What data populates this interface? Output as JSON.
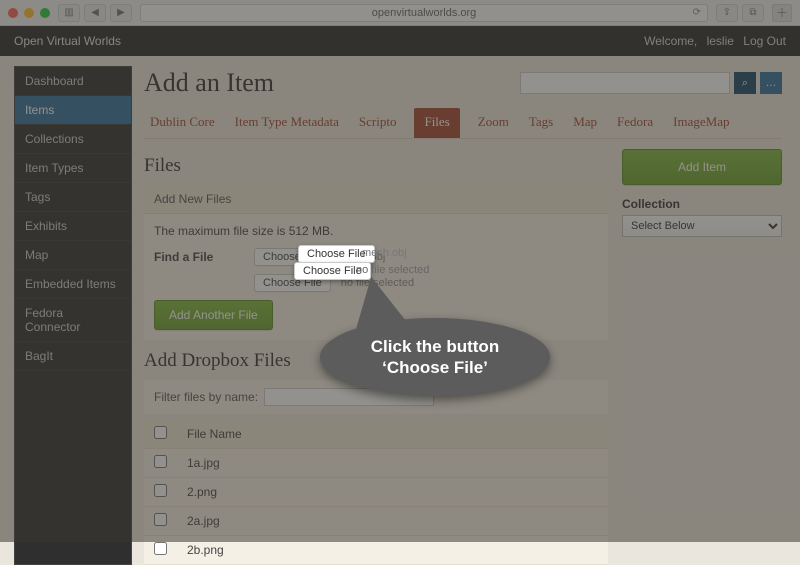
{
  "browser": {
    "url": "openvirtualworlds.org",
    "back_icon": "◀",
    "fwd_icon": "▶",
    "sidebar_icon": "▥",
    "reload_icon": "⟳",
    "share_icon": "⇪",
    "tabs_icon": "⧉",
    "plus": "＋"
  },
  "header": {
    "site_title": "Open Virtual Worlds",
    "welcome_prefix": "Welcome, ",
    "username": "leslie",
    "logout": "Log Out"
  },
  "sidebar": {
    "items": [
      {
        "label": "Dashboard"
      },
      {
        "label": "Items"
      },
      {
        "label": "Collections"
      },
      {
        "label": "Item Types"
      },
      {
        "label": "Tags"
      },
      {
        "label": "Exhibits"
      },
      {
        "label": "Map"
      },
      {
        "label": "Embedded Items"
      },
      {
        "label": "Fedora Connector"
      },
      {
        "label": "BagIt"
      }
    ],
    "active_index": 1
  },
  "page": {
    "title": "Add an Item",
    "search_placeholder": "",
    "search_icon": "⌕",
    "more_icon": "…"
  },
  "tabs": {
    "items": [
      "Dublin Core",
      "Item Type Metadata",
      "Scripto",
      "Files",
      "Zoom",
      "Tags",
      "Map",
      "Fedora",
      "ImageMap"
    ],
    "active_index": 3
  },
  "files": {
    "heading": "Files",
    "panel_title": "Add New Files",
    "max_note": "The maximum file size is 512 MB.",
    "find_label": "Find a File",
    "choose_button": "Choose File",
    "file1_name": "mesh.obj",
    "file2_status": "no file selected",
    "add_another": "Add Another File"
  },
  "right": {
    "add_item": "Add Item",
    "collection_label": "Collection",
    "collection_value": "Select Below"
  },
  "dropbox": {
    "heading": "Add Dropbox Files",
    "filter_label": "Filter files by name:",
    "col_filename": "File Name",
    "rows": [
      "1a.jpg",
      "2.png",
      "2a.jpg",
      "2b.png"
    ]
  },
  "callout": {
    "line1": "Click the button",
    "line2": "‘Choose File’"
  }
}
